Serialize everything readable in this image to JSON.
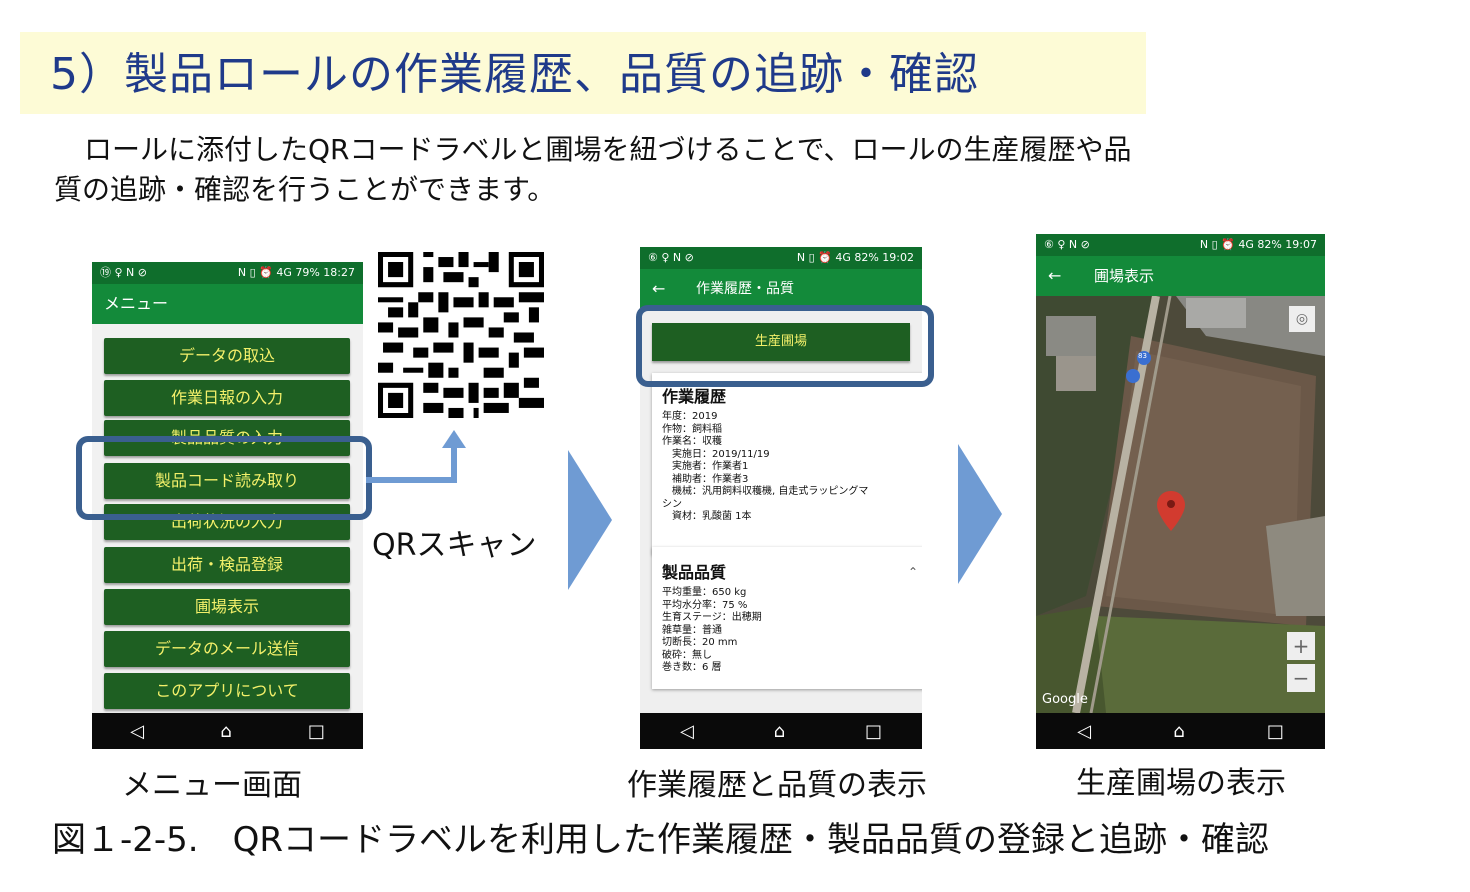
{
  "title": "5）製品ロールの作業履歴、品質の追跡・確認",
  "paragraph": {
    "line1": "ロールに添付したQRコードラベルと圃場を紐づけることで、ロールの生産履歴や品",
    "line2": "質の追跡・確認を行うことができます。"
  },
  "screen1": {
    "status_left": "⑲ ♀ N ⊘",
    "status_right": "N ▯ ⏰ 4G 79% 18:27",
    "appbar_title": "メニュー",
    "menu_items": [
      "データの取込",
      "作業日報の入力",
      "製品品質の入力",
      "製品コード読み取り",
      "出荷状況の入力",
      "出荷・検品登録",
      "圃場表示",
      "データのメール送信",
      "このアプリについて"
    ],
    "caption": "メニュー画面"
  },
  "qr_label": "QRスキャン",
  "screen2": {
    "status_left": "⑥ ♀ N ⊘",
    "status_right": "N ▯ ⏰ 4G 82% 19:02",
    "appbar_title": "作業履歴・品質",
    "back_icon": "←",
    "field_button": "生産圃場",
    "history_title": "作業履歴",
    "history_lines": [
      "年度：2019",
      "作物：飼料稲",
      "作業名：収穫",
      "　実施日：2019/11/19",
      "　実施者：作業者1",
      "　補助者：作業者3",
      "　機械：汎用飼料収穫機, 自走式ラッピングマ",
      "シン",
      "　資材：乳酸菌 1本"
    ],
    "quality_title": "製品品質",
    "quality_lines": [
      "平均重量：650 kg",
      "平均水分率：75 %",
      "生育ステージ：出穂期",
      "雑草量：普通",
      "切断長：20 mm",
      "破砕：無し",
      "巻き数：6 層"
    ],
    "caption": "作業履歴と品質の表示"
  },
  "screen3": {
    "status_left": "⑥ ♀ N ⊘",
    "status_right": "N ▯ ⏰ 4G 82% 19:07",
    "appbar_title": "圃場表示",
    "back_icon": "←",
    "google_label": "Google",
    "zoom_in": "+",
    "zoom_out": "−",
    "road_label": "83",
    "caption": "生産圃場の表示"
  },
  "figure_caption": "図１-2-5.　QRコードラベルを利用した作業履歴・製品品質の登録と追跡・確認",
  "colors": {
    "title": "#1f3a8a",
    "title_bg": "#fdfbd6",
    "menu_button": "#1e5f22",
    "menu_text": "#f3f06a",
    "highlight_border": "#3a5f8f",
    "arrow": "#6f9bd3",
    "appbar": "#138a3a"
  }
}
